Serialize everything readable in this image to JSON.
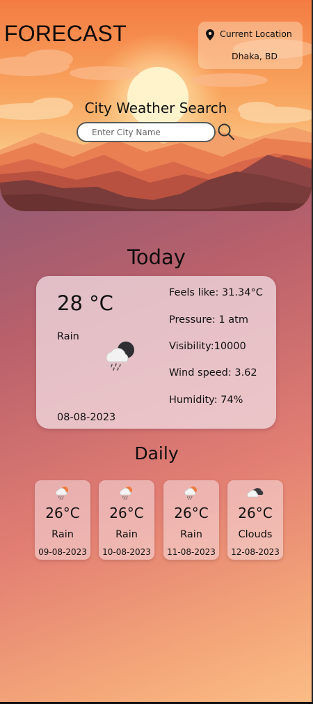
{
  "app": {
    "title": "FORECAST"
  },
  "location": {
    "label": "Current Location",
    "city": "Dhaka, BD"
  },
  "search": {
    "title": "City Weather Search",
    "placeholder": "Enter City Name",
    "value": ""
  },
  "today": {
    "heading": "Today",
    "temperature": "28 °C",
    "condition": "Rain",
    "icon": "rain-cloud-night-icon",
    "date": "08-08-2023",
    "details": [
      {
        "text": "Feels like: 31.34°C"
      },
      {
        "text": "Pressure: 1 atm"
      },
      {
        "text": "Visibility:10000"
      },
      {
        "text": "Wind speed: 3.62"
      },
      {
        "text": "Humidity: 74%"
      }
    ]
  },
  "daily": {
    "heading": "Daily",
    "days": [
      {
        "temp": "26°C",
        "condition": "Rain",
        "date": "09-08-2023",
        "icon": "rain-sun-icon"
      },
      {
        "temp": "26°C",
        "condition": "Rain",
        "date": "10-08-2023",
        "icon": "rain-sun-icon"
      },
      {
        "temp": "26°C",
        "condition": "Rain",
        "date": "11-08-2023",
        "icon": "rain-sun-icon"
      },
      {
        "temp": "26°C",
        "condition": "Clouds",
        "date": "12-08-2023",
        "icon": "clouds-icon"
      }
    ]
  },
  "colors": {
    "sky_top": "#f68a4e",
    "sun": "#fff1c8",
    "mountain_dark": "#7a3c3a",
    "card_bg": "#f0dae0"
  }
}
